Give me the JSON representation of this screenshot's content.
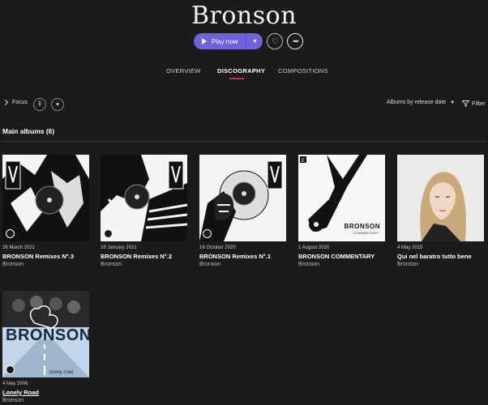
{
  "artist": {
    "name": "Bronson"
  },
  "actions": {
    "play_label": "Play now",
    "dropdown_icon": "chevron-down-icon",
    "favorite_icon": "heart-icon",
    "more_icon": "more-icon"
  },
  "tabs": [
    {
      "label": "OVERVIEW",
      "active": false
    },
    {
      "label": "DISCOGRAPHY",
      "active": true
    },
    {
      "label": "COMPOSITIONS",
      "active": false
    }
  ],
  "toolbar": {
    "focus_label": "Focus",
    "library_icon": "library-icon",
    "heart_icon": "heart-icon",
    "sort_label": "Albums by release date",
    "filter_label": "Filter"
  },
  "section": {
    "title": "Main albums (6)"
  },
  "albums": [
    {
      "date": "26 March 2021",
      "title": "BRONSON Remixes N°.3",
      "artist": "Bronson"
    },
    {
      "date": "29 January 2021",
      "title": "BRONSON Remixes N°.2",
      "artist": "Bronson"
    },
    {
      "date": "16 October 2020",
      "title": "BRONSON Remixes N°.1",
      "artist": "Bronson"
    },
    {
      "date": "1 August 2020",
      "title": "BRONSON COMMENTARY",
      "artist": "Bronson"
    },
    {
      "date": "4 May 2015",
      "title": "Qui nel baratro tutto bene",
      "artist": "Bronson"
    },
    {
      "date": "4 May 2006",
      "title": "Lonely Road",
      "artist": "Bronson"
    }
  ],
  "cover_text": {
    "commentary_logo": "BRONSON",
    "commentary_sub": "COMMENTARY",
    "lonely_logo": "BRONSON",
    "lonely_sub": "lonely road"
  },
  "colors": {
    "accent": "#6e63d9",
    "tab_indicator": "#d0302f",
    "background": "#1b1b1b"
  }
}
